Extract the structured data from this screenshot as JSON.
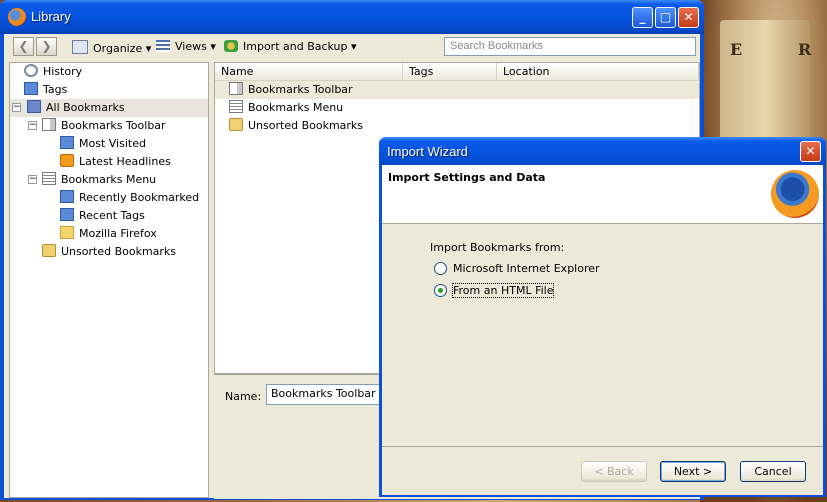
{
  "library": {
    "title": "Library",
    "window_controls": [
      "minimize",
      "maximize",
      "close"
    ],
    "toolbar": {
      "back_label": "❮",
      "forward_label": "❯",
      "organize_label": "Organize",
      "views_label": "Views",
      "import_label": "Import and Backup",
      "search_placeholder": "Search Bookmarks"
    },
    "tree": [
      {
        "label": "History"
      },
      {
        "label": "Tags"
      },
      {
        "label": "All Bookmarks"
      },
      {
        "label": "Bookmarks Toolbar"
      },
      {
        "label": "Most Visited"
      },
      {
        "label": "Latest Headlines"
      },
      {
        "label": "Bookmarks Menu"
      },
      {
        "label": "Recently Bookmarked"
      },
      {
        "label": "Recent Tags"
      },
      {
        "label": "Mozilla Firefox"
      },
      {
        "label": "Unsorted Bookmarks"
      }
    ],
    "columns": [
      "Name",
      "Tags",
      "Location"
    ],
    "rows": [
      {
        "name": "Bookmarks Toolbar"
      },
      {
        "name": "Bookmarks Menu"
      },
      {
        "name": "Unsorted Bookmarks"
      }
    ],
    "details": {
      "name_label": "Name:",
      "name_value": "Bookmarks Toolbar"
    }
  },
  "wizard": {
    "title": "Import Wizard",
    "header": "Import Settings and Data",
    "question": "Import Bookmarks from:",
    "options": [
      {
        "label": "Microsoft Internet Explorer",
        "selected": false
      },
      {
        "label": "From an HTML File",
        "selected": true
      }
    ],
    "buttons": {
      "back": "< Back",
      "next": "Next >",
      "cancel": "Cancel"
    }
  },
  "desktop": {
    "letters": [
      "E",
      "R"
    ]
  }
}
